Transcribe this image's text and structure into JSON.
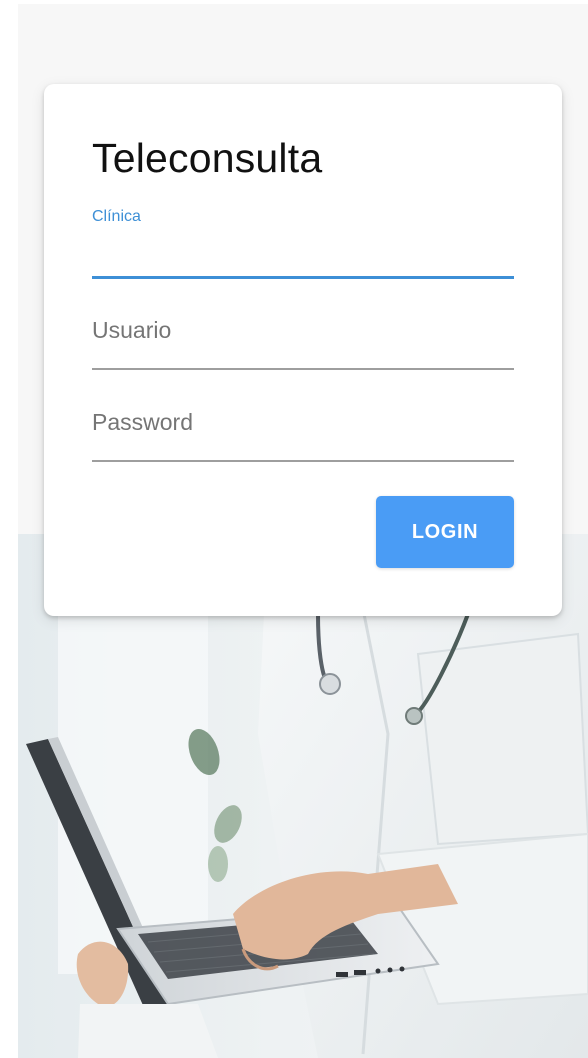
{
  "app": {
    "title": "Teleconsulta"
  },
  "form": {
    "clinic": {
      "label": "Clínica",
      "value": ""
    },
    "username": {
      "placeholder": "Usuario",
      "value": ""
    },
    "password": {
      "placeholder": "Password",
      "value": ""
    },
    "login_label": "LOGIN"
  },
  "colors": {
    "accent": "#3d8fd6",
    "button": "#4a9cf5",
    "card": "#ffffff",
    "background": "#f7f7f7"
  },
  "background_image": {
    "icon": "doctor-with-laptop-photo"
  }
}
